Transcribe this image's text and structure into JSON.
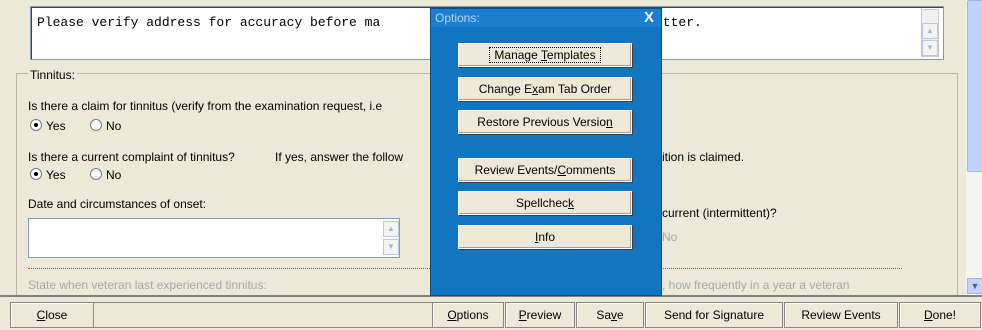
{
  "note": {
    "text": "Please verify address for accuracy before ma",
    "text_tail": "etter."
  },
  "tinnitus": {
    "group_label": "Tinnitus:",
    "claim_question": "Is there a claim for tinnitus (verify from the examination request, i.e",
    "claim_yes": "Yes",
    "claim_no": "No",
    "complaint_question": "Is there a current complaint of tinnitus?",
    "complaint_follow": "If yes, answer the follow",
    "complaint_tail": "ition is claimed.",
    "complaint_yes": "Yes",
    "complaint_no": "No",
    "onset_label": "Date and circumstances of onset:",
    "recurrent_label": "current (intermittent)?",
    "recurrent_no": "No",
    "last_experienced": "State when veteran last experienced tinnitus:",
    "frequency_tail": ", how frequently in a year a veteran"
  },
  "options_popup": {
    "title": "Options:",
    "close": "X",
    "buttons": [
      {
        "pre": "Manage ",
        "u": "T",
        "post": "emplates"
      },
      {
        "pre": "Change E",
        "u": "x",
        "post": "am Tab Order"
      },
      {
        "pre": "Restore Previous Versio",
        "u": "n",
        "post": ""
      },
      {
        "pre": "Review Events/",
        "u": "C",
        "post": "omments"
      },
      {
        "pre": "Spellchec",
        "u": "k",
        "post": ""
      },
      {
        "pre": "",
        "u": "I",
        "post": "nfo"
      }
    ]
  },
  "bottom_bar": {
    "close": {
      "u": "C",
      "rest": "lose"
    },
    "options": {
      "u": "O",
      "rest": "ptions"
    },
    "preview": {
      "u": "P",
      "rest": "review"
    },
    "save": {
      "pre": "Sa",
      "u": "v",
      "rest": "e"
    },
    "send": "Send for Signature",
    "review": "Review Events",
    "done": {
      "u": "D",
      "rest": "one!"
    }
  },
  "colors": {
    "popup_bg": "#1275c2",
    "form_bg": "#ece9d8"
  },
  "icons": [
    "scroll-up-icon",
    "scroll-down-icon",
    "close-icon"
  ]
}
